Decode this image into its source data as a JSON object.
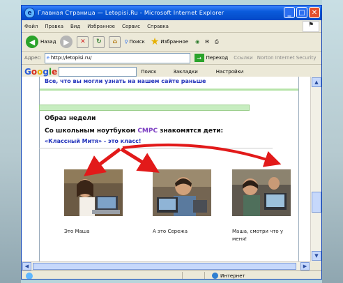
{
  "window": {
    "title": "Главная Страница — Letopisi.Ru - Microsoft Internet Explorer",
    "min": "_",
    "max": "□",
    "close": "✕"
  },
  "menu": [
    "Файл",
    "Правка",
    "Вид",
    "Избранное",
    "Сервис",
    "Справка"
  ],
  "toolbar": {
    "back_label": "Назад",
    "search_label": "Поиск",
    "favorites_label": "Избранное"
  },
  "address": {
    "label": "Адрес:",
    "url": "http://letopisi.ru/",
    "go_label": "Переход",
    "links_label": "Ссылки",
    "security_label": "Norton Internet Security"
  },
  "google": {
    "logo": "Google",
    "search_label": "Поиск",
    "bookmarks_label": "Закладки",
    "settings_label": "Настройки"
  },
  "content": {
    "prev_link": "Все, что вы могли узнать на нашем сайте раньше",
    "section_title": "Образ недели",
    "intro_prefix": "Со школьным ноутбуком ",
    "intro_brand": "СМРС",
    "intro_suffix": " знакомятся дети:",
    "class_link": "«Классный Митя» - это класс!",
    "captions": [
      "Это Маша",
      "А это Сережа",
      "Маша, смотри что у меня!"
    ]
  },
  "status": {
    "zone": "Интернет"
  },
  "colors": {
    "arrow": "#e21a1a",
    "titlebar": "#0a5bdb",
    "link": "#2233bb",
    "brand": "#7b3cc2"
  }
}
